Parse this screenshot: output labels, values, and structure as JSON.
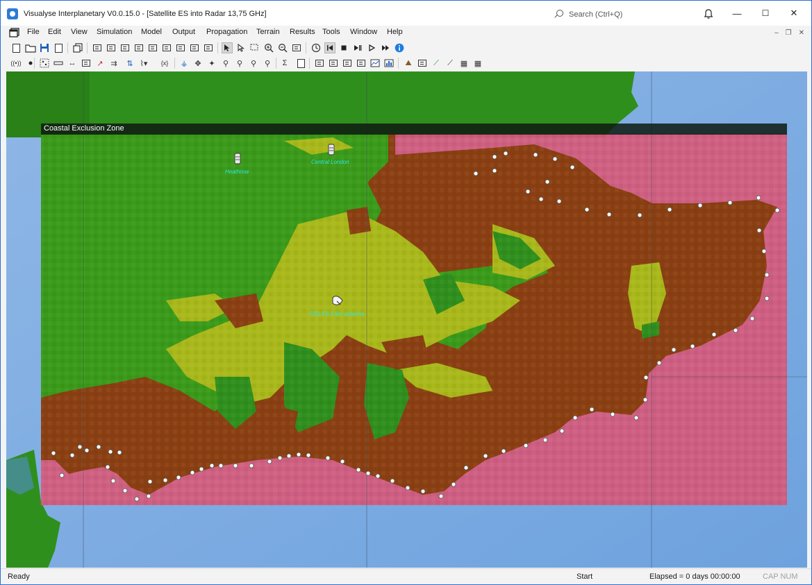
{
  "window": {
    "title": "Visualyse Interplanetary V0.0.15.0 - [Satellite ES into Radar 13,75 GHz]",
    "search_placeholder": "Search (Ctrl+Q)",
    "minimize": "—",
    "maximize": "☐",
    "close": "✕"
  },
  "menu": [
    "File",
    "Edit",
    "View",
    "Simulation",
    "Model",
    "Output",
    "Propagation",
    "Terrain",
    "Results",
    "Tools",
    "Window",
    "Help"
  ],
  "mdi": {
    "minimize": "–",
    "restore": "❐",
    "close": "✕"
  },
  "map": {
    "zone_label": "Coastal Exclusion Zone",
    "stations": [
      {
        "name": "Heathrow",
        "icon": "radar-tower-icon"
      },
      {
        "name": "Central London",
        "icon": "radar-tower-icon"
      },
      {
        "name": "FSS ES 2,6m antenna",
        "icon": "satellite-dish-icon"
      }
    ]
  },
  "status": {
    "ready": "Ready",
    "start": "Start",
    "elapsed": "Elapsed = 0 days 00:00:00",
    "caps": "CAP NUM"
  },
  "colors": {
    "sea": "#7aa9e0",
    "land_green": "#3a9a1a",
    "land_yellow": "#a9b81a",
    "exclusion_brown": "#8a3f12",
    "exclusion_pink": "#d6597a",
    "title_accent": "#2b6fd6"
  }
}
